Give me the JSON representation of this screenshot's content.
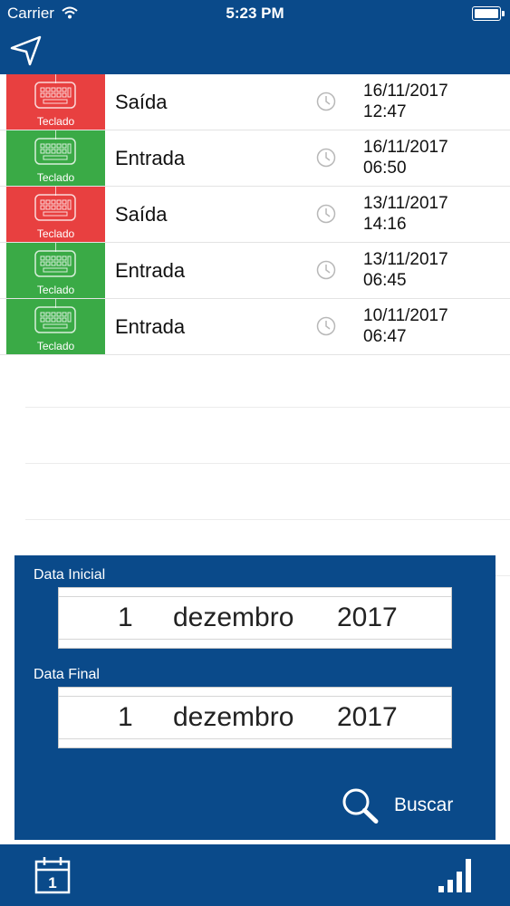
{
  "status_bar": {
    "carrier": "Carrier",
    "time": "5:23 PM"
  },
  "nav": {
    "back_icon": "back-arrow-icon"
  },
  "colors": {
    "primary": "#0a4a8a",
    "saida": "#e84040",
    "entrada": "#3aaa46"
  },
  "records": [
    {
      "type": "Saída",
      "tile_label": "Teclado",
      "date": "16/11/2017",
      "time": "12:47",
      "color": "#e84040"
    },
    {
      "type": "Entrada",
      "tile_label": "Teclado",
      "date": "16/11/2017",
      "time": "06:50",
      "color": "#3aaa46"
    },
    {
      "type": "Saída",
      "tile_label": "Teclado",
      "date": "13/11/2017",
      "time": "14:16",
      "color": "#e84040"
    },
    {
      "type": "Entrada",
      "tile_label": "Teclado",
      "date": "13/11/2017",
      "time": "06:45",
      "color": "#3aaa46"
    },
    {
      "type": "Entrada",
      "tile_label": "Teclado",
      "date": "10/11/2017",
      "time": "06:47",
      "color": "#3aaa46"
    }
  ],
  "filter": {
    "start": {
      "label": "Data Inicial",
      "day": "1",
      "month": "dezembro",
      "year": "2017"
    },
    "end": {
      "label": "Data Final",
      "day": "1",
      "month": "dezembro",
      "year": "2017"
    },
    "search_label": "Buscar"
  },
  "tab_bar": {
    "calendar_day": "1"
  }
}
